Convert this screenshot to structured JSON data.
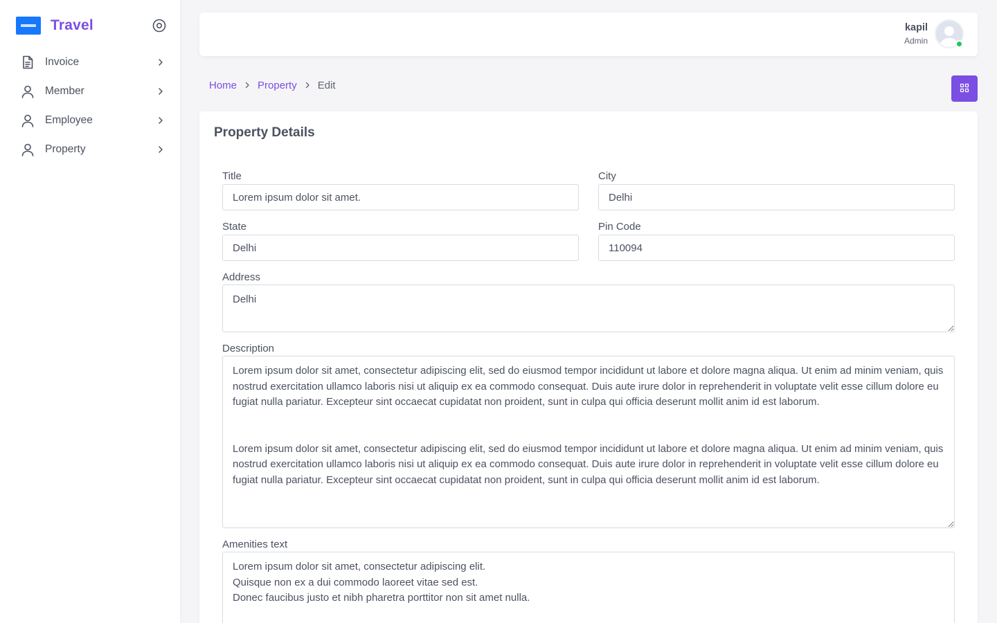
{
  "brand": {
    "name": "Travel",
    "logo_color": "#1677ff",
    "accent": "#7b4ee4"
  },
  "sidebar": {
    "items": [
      {
        "label": "Invoice",
        "icon": "document-icon"
      },
      {
        "label": "Member",
        "icon": "user-icon"
      },
      {
        "label": "Employee",
        "icon": "user-icon"
      },
      {
        "label": "Property",
        "icon": "user-icon"
      }
    ]
  },
  "header": {
    "user_name": "kapil",
    "user_role": "Admin",
    "status_color": "#22c55e"
  },
  "breadcrumb": {
    "home": "Home",
    "section": "Property",
    "current": "Edit"
  },
  "form": {
    "title": "Property Details",
    "title_label": "Title",
    "title_value": "Lorem ipsum dolor sit amet.",
    "city_label": "City",
    "city_value": "Delhi",
    "state_label": "State",
    "state_value": "Delhi",
    "pin_label": "Pin Code",
    "pin_value": "110094",
    "address_label": "Address",
    "address_value": "Delhi",
    "description_label": "Description",
    "description_value": "Lorem ipsum dolor sit amet, consectetur adipiscing elit, sed do eiusmod tempor incididunt ut labore et dolore magna aliqua. Ut enim ad minim veniam, quis nostrud exercitation ullamco laboris nisi ut aliquip ex ea commodo consequat. Duis aute irure dolor in reprehenderit in voluptate velit esse cillum dolore eu fugiat nulla pariatur. Excepteur sint occaecat cupidatat non proident, sunt in culpa qui officia deserunt mollit anim id est laborum.\n\n\nLorem ipsum dolor sit amet, consectetur adipiscing elit, sed do eiusmod tempor incididunt ut labore et dolore magna aliqua. Ut enim ad minim veniam, quis nostrud exercitation ullamco laboris nisi ut aliquip ex ea commodo consequat. Duis aute irure dolor in reprehenderit in voluptate velit esse cillum dolore eu fugiat nulla pariatur. Excepteur sint occaecat cupidatat non proident, sunt in culpa qui officia deserunt mollit anim id est laborum.",
    "amenities_label": "Amenities text",
    "amenities_value": "Lorem ipsum dolor sit amet, consectetur adipiscing elit.\nQuisque non ex a dui commodo laoreet vitae sed est.\nDonec faucibus justo et nibh pharetra porttitor non sit amet nulla."
  }
}
